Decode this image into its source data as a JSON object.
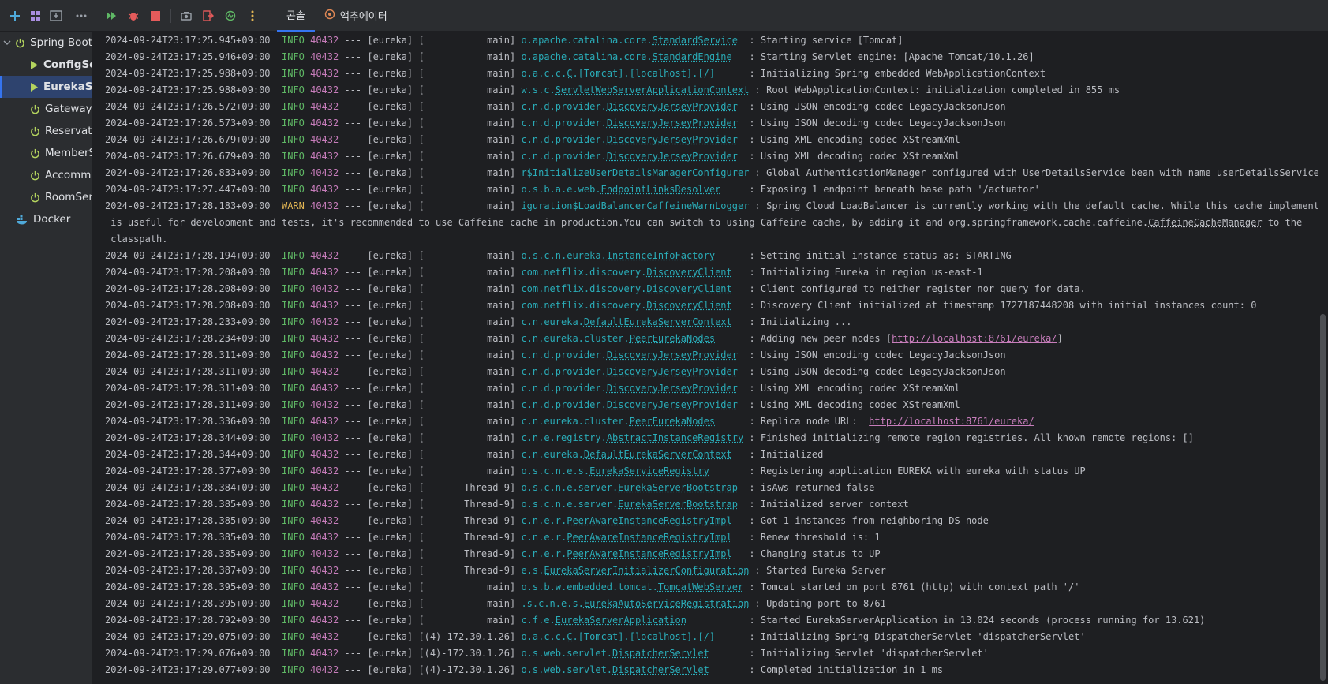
{
  "tabs": [
    {
      "label": "콘솔",
      "active": true
    },
    {
      "label": "액추에이터",
      "active": false
    }
  ],
  "sidebar": {
    "items": [
      {
        "label": "Spring Boot",
        "icon": "power-icon",
        "indent": 0,
        "bold": false,
        "selected": false,
        "expanded": true
      },
      {
        "label": "ConfigSe",
        "icon": "run-icon",
        "indent": 2,
        "bold": true,
        "selected": false
      },
      {
        "label": "EurekaSe",
        "icon": "run-icon",
        "indent": 2,
        "bold": true,
        "selected": true
      },
      {
        "label": "GatewayS",
        "icon": "power-icon",
        "indent": 2,
        "bold": false,
        "selected": false
      },
      {
        "label": "Reservatio",
        "icon": "power-icon",
        "indent": 2,
        "bold": false,
        "selected": false
      },
      {
        "label": "MemberS",
        "icon": "power-icon",
        "indent": 2,
        "bold": false,
        "selected": false
      },
      {
        "label": "Accommo",
        "icon": "power-icon",
        "indent": 2,
        "bold": false,
        "selected": false
      },
      {
        "label": "RoomSen",
        "icon": "power-icon",
        "indent": 2,
        "bold": false,
        "selected": false
      },
      {
        "label": "Docker",
        "icon": "docker-icon",
        "indent": 1,
        "bold": false,
        "selected": false
      }
    ]
  },
  "log": {
    "lines": [
      {
        "ts": "2024-09-24T23:17:25.945+09:00",
        "level": "INFO",
        "pid": "40432",
        "app": "[eureka]",
        "thread": "main",
        "loggerPrefix": "o.apache.catalina.core.",
        "loggerLink": "StandardService",
        "msg": "Starting service [Tomcat]"
      },
      {
        "ts": "2024-09-24T23:17:25.946+09:00",
        "level": "INFO",
        "pid": "40432",
        "app": "[eureka]",
        "thread": "main",
        "loggerPrefix": "o.apache.catalina.core.",
        "loggerLink": "StandardEngine",
        "msg": "Starting Servlet engine: [Apache Tomcat/10.1.26]"
      },
      {
        "ts": "2024-09-24T23:17:25.988+09:00",
        "level": "INFO",
        "pid": "40432",
        "app": "[eureka]",
        "thread": "main",
        "loggerPrefix": "o.a.c.c.",
        "loggerLink": "C",
        "loggerSuffix": ".[Tomcat].[localhost].[/]",
        "msg": "Initializing Spring embedded WebApplicationContext"
      },
      {
        "ts": "2024-09-24T23:17:25.988+09:00",
        "level": "INFO",
        "pid": "40432",
        "app": "[eureka]",
        "thread": "main",
        "loggerPrefix": "w.s.c.",
        "loggerLink": "ServletWebServerApplicationContext",
        "msg": "Root WebApplicationContext: initialization completed in 855 ms"
      },
      {
        "ts": "2024-09-24T23:17:26.572+09:00",
        "level": "INFO",
        "pid": "40432",
        "app": "[eureka]",
        "thread": "main",
        "loggerPrefix": "c.n.d.provider.",
        "loggerLink": "DiscoveryJerseyProvider",
        "msg": "Using JSON encoding codec LegacyJacksonJson"
      },
      {
        "ts": "2024-09-24T23:17:26.573+09:00",
        "level": "INFO",
        "pid": "40432",
        "app": "[eureka]",
        "thread": "main",
        "loggerPrefix": "c.n.d.provider.",
        "loggerLink": "DiscoveryJerseyProvider",
        "msg": "Using JSON decoding codec LegacyJacksonJson"
      },
      {
        "ts": "2024-09-24T23:17:26.679+09:00",
        "level": "INFO",
        "pid": "40432",
        "app": "[eureka]",
        "thread": "main",
        "loggerPrefix": "c.n.d.provider.",
        "loggerLink": "DiscoveryJerseyProvider",
        "msg": "Using XML encoding codec XStreamXml"
      },
      {
        "ts": "2024-09-24T23:17:26.679+09:00",
        "level": "INFO",
        "pid": "40432",
        "app": "[eureka]",
        "thread": "main",
        "loggerPrefix": "c.n.d.provider.",
        "loggerLink": "DiscoveryJerseyProvider",
        "msg": "Using XML decoding codec XStreamXml"
      },
      {
        "ts": "2024-09-24T23:17:26.833+09:00",
        "level": "INFO",
        "pid": "40432",
        "app": "[eureka]",
        "thread": "main",
        "loggerPrefix": "r$InitializeUserDetailsManagerConfigurer",
        "loggerLink": "",
        "msg": "Global AuthenticationManager configured with UserDetailsService bean with name userDetailsService"
      },
      {
        "ts": "2024-09-24T23:17:27.447+09:00",
        "level": "INFO",
        "pid": "40432",
        "app": "[eureka]",
        "thread": "main",
        "loggerPrefix": "o.s.b.a.e.web.",
        "loggerLink": "EndpointLinksResolver",
        "msg": "Exposing 1 endpoint beneath base path '/actuator'"
      },
      {
        "ts": "2024-09-24T23:17:28.183+09:00",
        "level": "WARN",
        "pid": "40432",
        "app": "[eureka]",
        "thread": "main",
        "loggerPrefix": "iguration$LoadBalancerCaffeineWarnLogger",
        "loggerLink": "",
        "msg": "Spring Cloud LoadBalancer is currently working with the default cache. While this cache implementation"
      },
      {
        "cont": " is useful for development and tests, it's recommended to use Caffeine cache in production.You can switch to using Caffeine cache, by adding it and org.springframework.cache.caffeine.",
        "contLink": "CaffeineCacheManager",
        "contSuffix": " to the"
      },
      {
        "cont": " classpath."
      },
      {
        "ts": "2024-09-24T23:17:28.194+09:00",
        "level": "INFO",
        "pid": "40432",
        "app": "[eureka]",
        "thread": "main",
        "loggerPrefix": "o.s.c.n.eureka.",
        "loggerLink": "InstanceInfoFactory",
        "msg": "Setting initial instance status as: STARTING"
      },
      {
        "ts": "2024-09-24T23:17:28.208+09:00",
        "level": "INFO",
        "pid": "40432",
        "app": "[eureka]",
        "thread": "main",
        "loggerPrefix": "com.netflix.discovery.",
        "loggerLink": "DiscoveryClient",
        "msg": "Initializing Eureka in region us-east-1"
      },
      {
        "ts": "2024-09-24T23:17:28.208+09:00",
        "level": "INFO",
        "pid": "40432",
        "app": "[eureka]",
        "thread": "main",
        "loggerPrefix": "com.netflix.discovery.",
        "loggerLink": "DiscoveryClient",
        "msg": "Client configured to neither register nor query for data."
      },
      {
        "ts": "2024-09-24T23:17:28.208+09:00",
        "level": "INFO",
        "pid": "40432",
        "app": "[eureka]",
        "thread": "main",
        "loggerPrefix": "com.netflix.discovery.",
        "loggerLink": "DiscoveryClient",
        "msg": "Discovery Client initialized at timestamp 1727187448208 with initial instances count: 0"
      },
      {
        "ts": "2024-09-24T23:17:28.233+09:00",
        "level": "INFO",
        "pid": "40432",
        "app": "[eureka]",
        "thread": "main",
        "loggerPrefix": "c.n.eureka.",
        "loggerLink": "DefaultEurekaServerContext",
        "msg": "Initializing ..."
      },
      {
        "ts": "2024-09-24T23:17:28.234+09:00",
        "level": "INFO",
        "pid": "40432",
        "app": "[eureka]",
        "thread": "main",
        "loggerPrefix": "c.n.eureka.cluster.",
        "loggerLink": "PeerEurekaNodes",
        "msg": "Adding new peer nodes [",
        "msgLink": "http://localhost:8761/eureka/",
        "msgSuffix": "]"
      },
      {
        "ts": "2024-09-24T23:17:28.311+09:00",
        "level": "INFO",
        "pid": "40432",
        "app": "[eureka]",
        "thread": "main",
        "loggerPrefix": "c.n.d.provider.",
        "loggerLink": "DiscoveryJerseyProvider",
        "msg": "Using JSON encoding codec LegacyJacksonJson"
      },
      {
        "ts": "2024-09-24T23:17:28.311+09:00",
        "level": "INFO",
        "pid": "40432",
        "app": "[eureka]",
        "thread": "main",
        "loggerPrefix": "c.n.d.provider.",
        "loggerLink": "DiscoveryJerseyProvider",
        "msg": "Using JSON decoding codec LegacyJacksonJson"
      },
      {
        "ts": "2024-09-24T23:17:28.311+09:00",
        "level": "INFO",
        "pid": "40432",
        "app": "[eureka]",
        "thread": "main",
        "loggerPrefix": "c.n.d.provider.",
        "loggerLink": "DiscoveryJerseyProvider",
        "msg": "Using XML encoding codec XStreamXml"
      },
      {
        "ts": "2024-09-24T23:17:28.311+09:00",
        "level": "INFO",
        "pid": "40432",
        "app": "[eureka]",
        "thread": "main",
        "loggerPrefix": "c.n.d.provider.",
        "loggerLink": "DiscoveryJerseyProvider",
        "msg": "Using XML decoding codec XStreamXml"
      },
      {
        "ts": "2024-09-24T23:17:28.336+09:00",
        "level": "INFO",
        "pid": "40432",
        "app": "[eureka]",
        "thread": "main",
        "loggerPrefix": "c.n.eureka.cluster.",
        "loggerLink": "PeerEurekaNodes",
        "msg": "Replica node URL:  ",
        "msgLink": "http://localhost:8761/eureka/",
        "msgSuffix": ""
      },
      {
        "ts": "2024-09-24T23:17:28.344+09:00",
        "level": "INFO",
        "pid": "40432",
        "app": "[eureka]",
        "thread": "main",
        "loggerPrefix": "c.n.e.registry.",
        "loggerLink": "AbstractInstanceRegistry",
        "msg": "Finished initializing remote region registries. All known remote regions: []"
      },
      {
        "ts": "2024-09-24T23:17:28.344+09:00",
        "level": "INFO",
        "pid": "40432",
        "app": "[eureka]",
        "thread": "main",
        "loggerPrefix": "c.n.eureka.",
        "loggerLink": "DefaultEurekaServerContext",
        "msg": "Initialized"
      },
      {
        "ts": "2024-09-24T23:17:28.377+09:00",
        "level": "INFO",
        "pid": "40432",
        "app": "[eureka]",
        "thread": "main",
        "loggerPrefix": "o.s.c.n.e.s.",
        "loggerLink": "EurekaServiceRegistry",
        "msg": "Registering application EUREKA with eureka with status UP"
      },
      {
        "ts": "2024-09-24T23:17:28.384+09:00",
        "level": "INFO",
        "pid": "40432",
        "app": "[eureka]",
        "thread": "Thread-9",
        "loggerPrefix": "o.s.c.n.e.server.",
        "loggerLink": "EurekaServerBootstrap",
        "msg": "isAws returned false"
      },
      {
        "ts": "2024-09-24T23:17:28.385+09:00",
        "level": "INFO",
        "pid": "40432",
        "app": "[eureka]",
        "thread": "Thread-9",
        "loggerPrefix": "o.s.c.n.e.server.",
        "loggerLink": "EurekaServerBootstrap",
        "msg": "Initialized server context"
      },
      {
        "ts": "2024-09-24T23:17:28.385+09:00",
        "level": "INFO",
        "pid": "40432",
        "app": "[eureka]",
        "thread": "Thread-9",
        "loggerPrefix": "c.n.e.r.",
        "loggerLink": "PeerAwareInstanceRegistryImpl",
        "msg": "Got 1 instances from neighboring DS node"
      },
      {
        "ts": "2024-09-24T23:17:28.385+09:00",
        "level": "INFO",
        "pid": "40432",
        "app": "[eureka]",
        "thread": "Thread-9",
        "loggerPrefix": "c.n.e.r.",
        "loggerLink": "PeerAwareInstanceRegistryImpl",
        "msg": "Renew threshold is: 1"
      },
      {
        "ts": "2024-09-24T23:17:28.385+09:00",
        "level": "INFO",
        "pid": "40432",
        "app": "[eureka]",
        "thread": "Thread-9",
        "loggerPrefix": "c.n.e.r.",
        "loggerLink": "PeerAwareInstanceRegistryImpl",
        "msg": "Changing status to UP"
      },
      {
        "ts": "2024-09-24T23:17:28.387+09:00",
        "level": "INFO",
        "pid": "40432",
        "app": "[eureka]",
        "thread": "Thread-9",
        "loggerPrefix": "e.s.",
        "loggerLink": "EurekaServerInitializerConfiguration",
        "msg": "Started Eureka Server"
      },
      {
        "ts": "2024-09-24T23:17:28.395+09:00",
        "level": "INFO",
        "pid": "40432",
        "app": "[eureka]",
        "thread": "main",
        "loggerPrefix": "o.s.b.w.embedded.tomcat.",
        "loggerLink": "TomcatWebServer",
        "msg": "Tomcat started on port 8761 (http) with context path '/'"
      },
      {
        "ts": "2024-09-24T23:17:28.395+09:00",
        "level": "INFO",
        "pid": "40432",
        "app": "[eureka]",
        "thread": "main",
        "loggerPrefix": ".s.c.n.e.s.",
        "loggerLink": "EurekaAutoServiceRegistration",
        "msg": "Updating port to 8761"
      },
      {
        "ts": "2024-09-24T23:17:28.792+09:00",
        "level": "INFO",
        "pid": "40432",
        "app": "[eureka]",
        "thread": "main",
        "loggerPrefix": "c.f.e.",
        "loggerLink": "EurekaServerApplication",
        "msg": "Started EurekaServerApplication in 13.024 seconds (process running for 13.621)"
      },
      {
        "ts": "2024-09-24T23:17:29.075+09:00",
        "level": "INFO",
        "pid": "40432",
        "app": "[eureka]",
        "thread": "(4)-172.30.1.26",
        "loggerPrefix": "o.a.c.c.",
        "loggerLink": "C",
        "loggerSuffix": ".[Tomcat].[localhost].[/]",
        "msg": "Initializing Spring DispatcherServlet 'dispatcherServlet'"
      },
      {
        "ts": "2024-09-24T23:17:29.076+09:00",
        "level": "INFO",
        "pid": "40432",
        "app": "[eureka]",
        "thread": "(4)-172.30.1.26",
        "loggerPrefix": "o.s.web.servlet.",
        "loggerLink": "DispatcherServlet",
        "msg": "Initializing Servlet 'dispatcherServlet'"
      },
      {
        "ts": "2024-09-24T23:17:29.077+09:00",
        "level": "INFO",
        "pid": "40432",
        "app": "[eureka]",
        "thread": "(4)-172.30.1.26",
        "loggerPrefix": "o.s.web.servlet.",
        "loggerLink": "DispatcherServlet",
        "msg": "Completed initialization in 1 ms"
      }
    ]
  }
}
